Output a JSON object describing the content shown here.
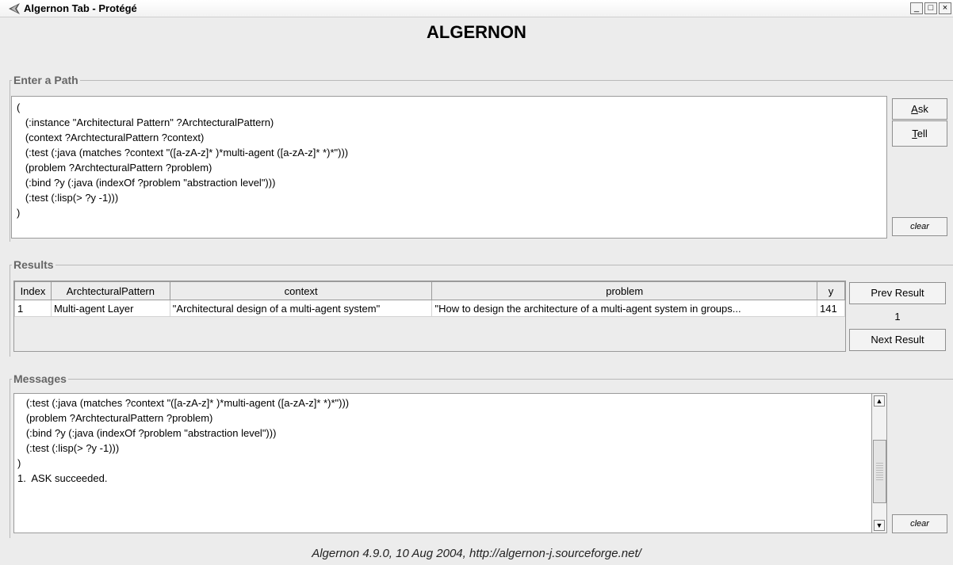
{
  "window": {
    "title": "Algernon Tab - Protégé",
    "minimize": "_",
    "maximize": "□",
    "close": "×"
  },
  "heading": "ALGERNON",
  "path_panel": {
    "legend": "Enter a Path",
    "text": "(\n   (:instance \"Architectural Pattern\" ?ArchtecturalPattern)\n   (context ?ArchtecturalPattern ?context)\n   (:test (:java (matches ?context \"([a-zA-z]* )*multi-agent ([a-zA-z]* *)*\")))\n   (problem ?ArchtecturalPattern ?problem)\n   (:bind ?y (:java (indexOf ?problem \"abstraction level\")))\n   (:test (:lisp(> ?y -1)))\n)",
    "ask_label_mnemonic": "A",
    "ask_label_rest": "sk",
    "tell_label_mnemonic": "T",
    "tell_label_rest": "ell",
    "clear_label": "clear"
  },
  "results_panel": {
    "legend": "Results",
    "columns": [
      "Index",
      "ArchtecturalPattern",
      "context",
      "problem",
      "y"
    ],
    "rows": [
      [
        "1",
        "Multi-agent Layer",
        "\"Architectural design of a multi-agent system\"",
        "\"How to design the architecture of a multi-agent system in groups...",
        "141"
      ]
    ],
    "prev_label": "Prev Result",
    "counter": "1",
    "next_label": "Next Result"
  },
  "messages_panel": {
    "legend": "Messages",
    "text": "   (:test (:java (matches ?context \"([a-zA-z]* )*multi-agent ([a-zA-z]* *)*\")))\n   (problem ?ArchtecturalPattern ?problem)\n   (:bind ?y (:java (indexOf ?problem \"abstraction level\")))\n   (:test (:lisp(> ?y -1)))\n)\n1.  ASK succeeded.",
    "clear_label": "clear"
  },
  "footer": "Algernon 4.9.0, 10 Aug 2004, http://algernon-j.sourceforge.net/"
}
